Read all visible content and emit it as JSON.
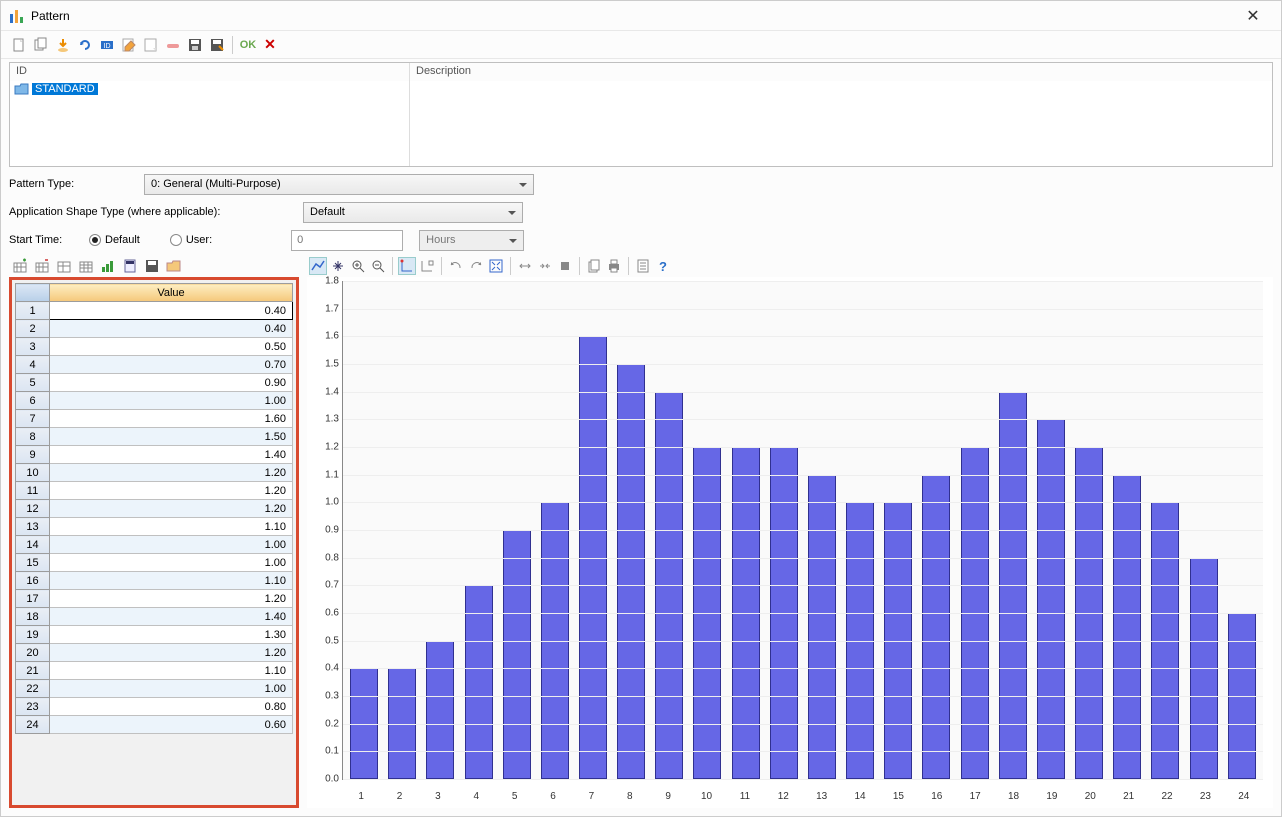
{
  "window": {
    "title": "Pattern"
  },
  "list": {
    "col_id": "ID",
    "col_desc": "Description",
    "item1": "STANDARD"
  },
  "form": {
    "pattern_type_label": "Pattern Type:",
    "pattern_type_value": "0: General (Multi-Purpose)",
    "shape_label": "Application Shape Type (where applicable):",
    "shape_value": "Default",
    "start_time_label": "Start Time:",
    "radio_default": "Default",
    "radio_user": "User:",
    "start_value": "0",
    "unit": "Hours"
  },
  "table": {
    "header": "Value"
  },
  "toolbar": {
    "ok": "OK"
  },
  "chart_data": {
    "type": "bar",
    "categories": [
      "1",
      "2",
      "3",
      "4",
      "5",
      "6",
      "7",
      "8",
      "9",
      "10",
      "11",
      "12",
      "13",
      "14",
      "15",
      "16",
      "17",
      "18",
      "19",
      "20",
      "21",
      "22",
      "23",
      "24"
    ],
    "values": [
      0.4,
      0.4,
      0.5,
      0.7,
      0.9,
      1.0,
      1.6,
      1.5,
      1.4,
      1.2,
      1.2,
      1.2,
      1.1,
      1.0,
      1.0,
      1.1,
      1.2,
      1.4,
      1.3,
      1.2,
      1.1,
      1.0,
      0.8,
      0.6
    ],
    "ylim": [
      0,
      1.8
    ],
    "ytick_step": 0.1,
    "title": "",
    "xlabel": "",
    "ylabel": ""
  }
}
